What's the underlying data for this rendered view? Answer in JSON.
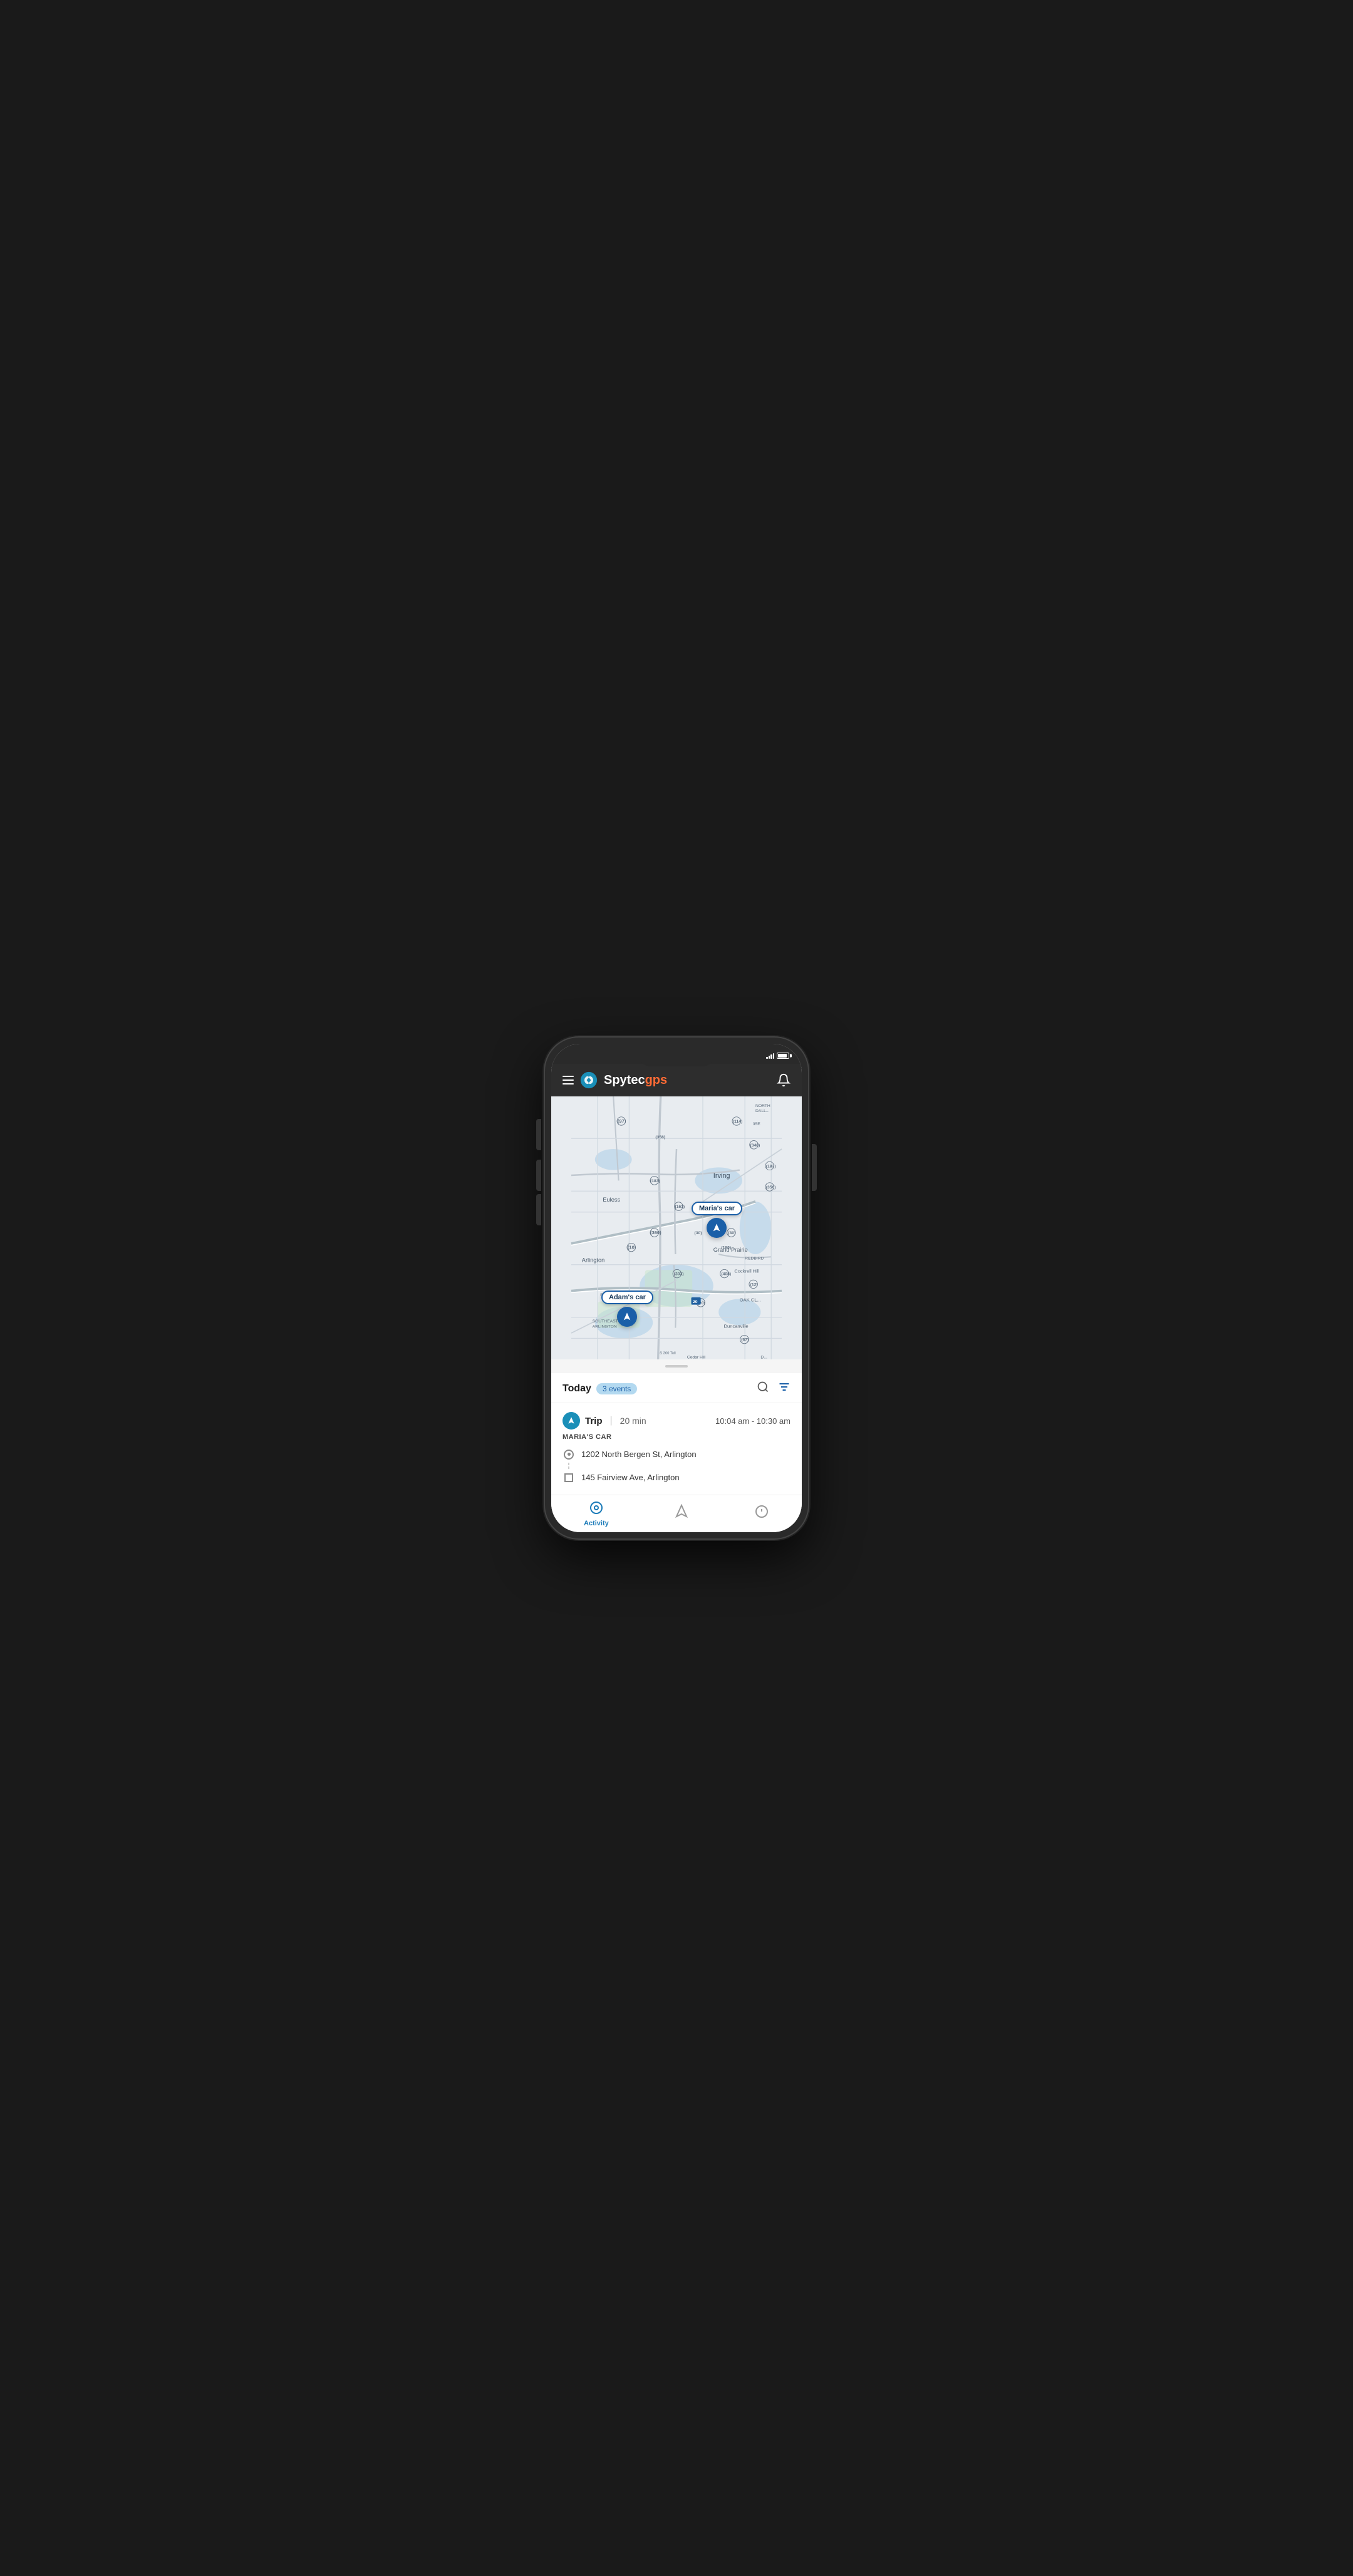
{
  "phone": {
    "status_bar": {
      "signal_label": "signal",
      "battery_label": "battery"
    },
    "header": {
      "menu_label": "menu",
      "app_name": "Spytec",
      "app_name_suffix": "gps",
      "bell_label": "notifications"
    },
    "map": {
      "markers": [
        {
          "id": "marias-car",
          "label": "Maria's car",
          "position": "top-right"
        },
        {
          "id": "adams-car",
          "label": "Adam's car",
          "position": "middle-left"
        }
      ]
    },
    "events_panel": {
      "today_label": "Today",
      "badge_text": "3 events",
      "trip": {
        "type_label": "Trip",
        "duration": "20 min",
        "time_range": "10:04 am - 10:30 am",
        "device_name": "MARIA'S CAR",
        "from_address": "1202 North Bergen St, Arlington",
        "to_address": "145 Fairview Ave, Arlington"
      }
    },
    "tab_bar": {
      "tabs": [
        {
          "id": "activity",
          "label": "Activity",
          "active": true
        },
        {
          "id": "locate",
          "label": "",
          "active": false
        },
        {
          "id": "alerts",
          "label": "",
          "active": false
        }
      ]
    }
  }
}
